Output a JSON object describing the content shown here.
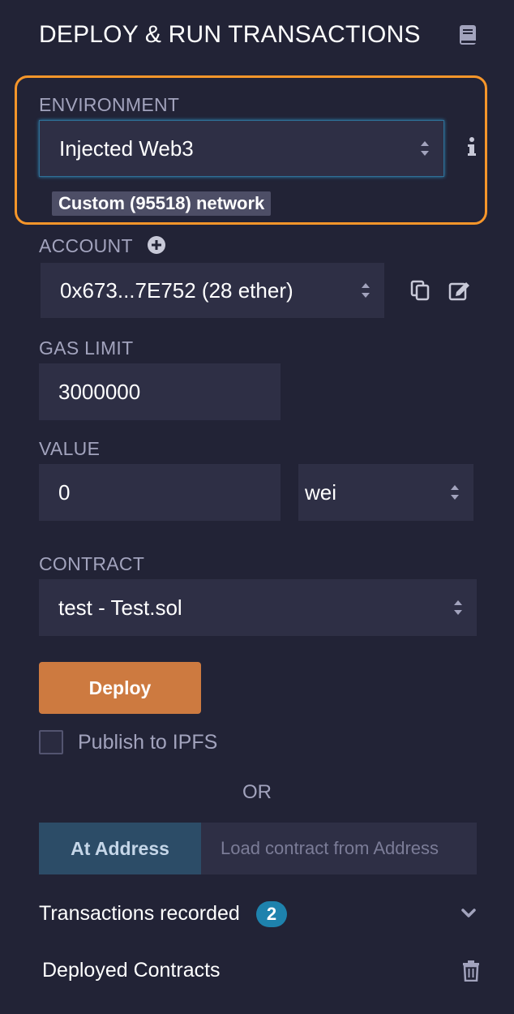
{
  "header": {
    "title": "DEPLOY & RUN TRANSACTIONS",
    "icon": "book-icon"
  },
  "environment": {
    "label": "ENVIRONMENT",
    "selected": "Injected Web3",
    "network_badge": "Custom (95518) network",
    "highlight_color": "#f7962a"
  },
  "account": {
    "label": "ACCOUNT",
    "selected": "0x673...7E752 (28 ether)"
  },
  "gas_limit": {
    "label": "GAS LIMIT",
    "value": "3000000"
  },
  "value": {
    "label": "VALUE",
    "amount": "0",
    "unit": "wei"
  },
  "contract": {
    "label": "CONTRACT",
    "selected": "test - Test.sol"
  },
  "deploy": {
    "label": "Deploy",
    "color": "#cd7a40"
  },
  "publish": {
    "label": "Publish to IPFS",
    "checked": false
  },
  "or_text": "OR",
  "at_address": {
    "button_label": "At Address",
    "placeholder": "Load contract from Address"
  },
  "transactions": {
    "label": "Transactions recorded",
    "count": "2"
  },
  "deployed": {
    "label": "Deployed Contracts"
  }
}
